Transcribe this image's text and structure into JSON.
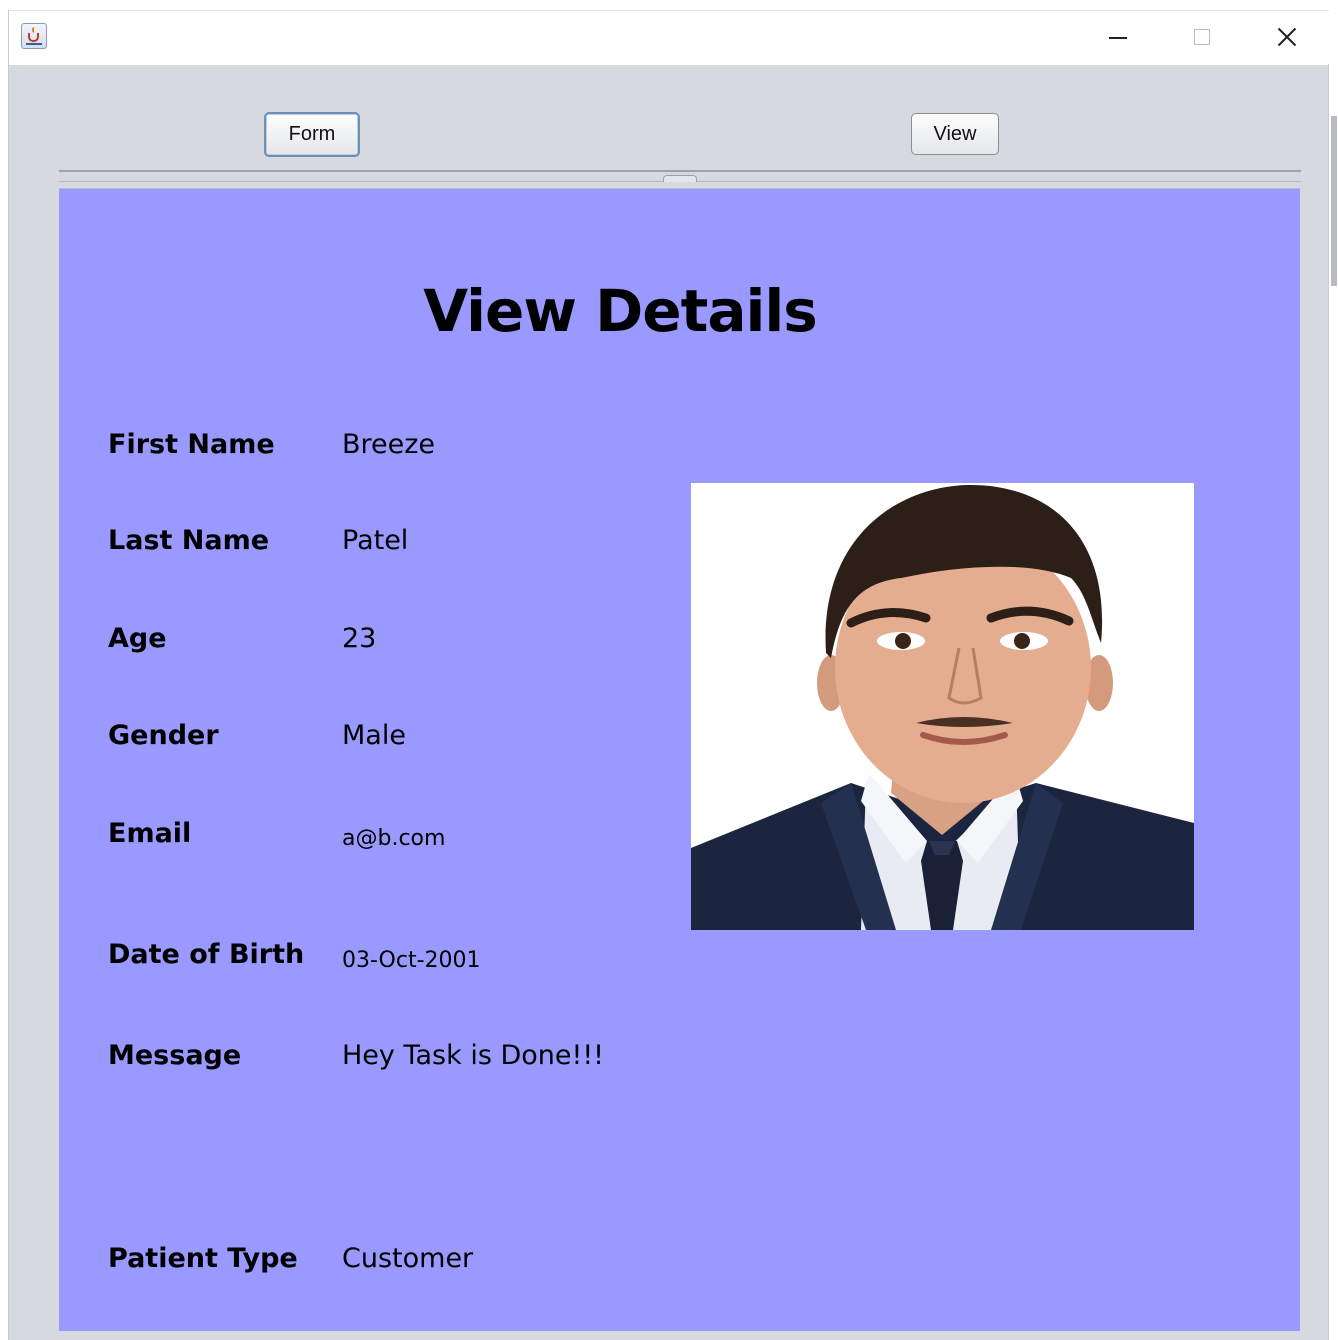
{
  "window": {
    "controls": {
      "minimize": "minimize-icon",
      "maximize": "maximize-icon",
      "close": "close-icon"
    },
    "app_icon": "java-icon"
  },
  "tabs": {
    "form_label": "Form",
    "view_label": "View"
  },
  "panel": {
    "background": "#9999ff",
    "title": "View Details",
    "fields": [
      {
        "label": "First Name",
        "value": "Breeze"
      },
      {
        "label": "Last Name",
        "value": "Patel"
      },
      {
        "label": "Age",
        "value": "23"
      },
      {
        "label": "Gender",
        "value": "Male"
      },
      {
        "label": "Email",
        "value": "a@b.com"
      },
      {
        "label": "Date of Birth",
        "value": "03-Oct-2001"
      },
      {
        "label": "Message",
        "value": "Hey Task is Done!!!"
      },
      {
        "label": "Patient Type",
        "value": "Customer"
      }
    ],
    "photo": "profile-photo"
  }
}
